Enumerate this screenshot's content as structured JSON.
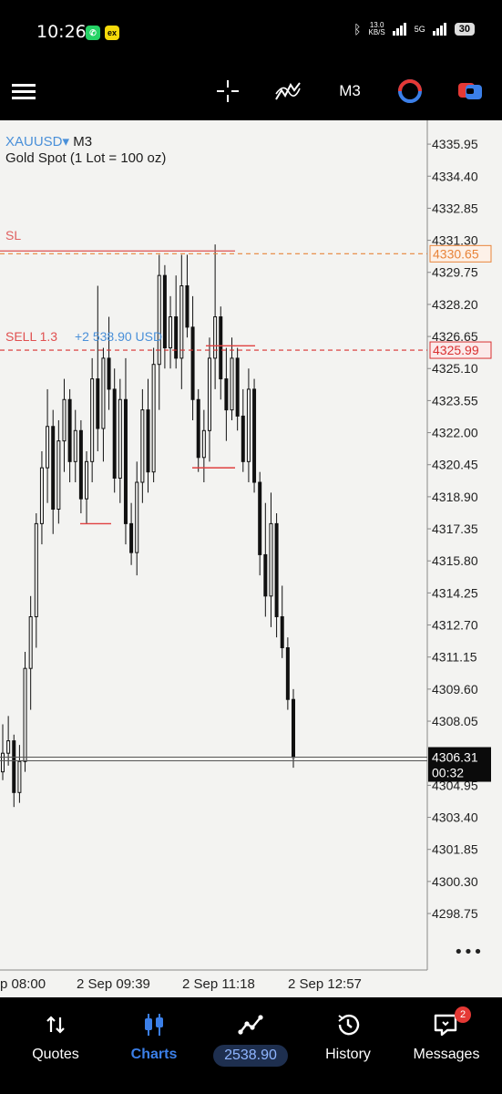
{
  "status_bar": {
    "time": "10:26",
    "app_icons": [
      "whatsapp-icon",
      "ex-app-icon"
    ],
    "net_speed": "13.0",
    "net_unit": "KB/S",
    "network": "5G",
    "battery": "30"
  },
  "toolbar": {
    "timeframe": "M3",
    "icons": [
      "menu-icon",
      "crosshair-icon",
      "indicators-icon",
      "timeframe",
      "objects-icon",
      "trade-icon"
    ]
  },
  "chart": {
    "symbol": "XAUUSD",
    "symbol_arrow": "▾",
    "timeframe": "M3",
    "description": "Gold Spot (1 Lot = 100 oz)",
    "sl_label": "SL",
    "sl_price": "4330.65",
    "sell_label": "SELL 1.3",
    "sell_pl": "+2 538.90 USD",
    "sell_price": "4325.99",
    "current_price": "4306.31",
    "countdown": "00:32",
    "more": "•••",
    "colors": {
      "sl": "#e8843a",
      "sell": "#d93030",
      "candle": "#111111",
      "bg": "#f3f3f1"
    }
  },
  "chart_data": {
    "type": "candlestick",
    "y_ticks": [
      "4335.95",
      "4334.40",
      "4332.85",
      "4331.30",
      "4329.75",
      "4328.20",
      "4326.65",
      "4325.10",
      "4323.55",
      "4322.00",
      "4320.45",
      "4318.90",
      "4317.35",
      "4315.80",
      "4314.25",
      "4312.70",
      "4311.15",
      "4309.60",
      "4308.05",
      "4304.95",
      "4303.40",
      "4301.85",
      "4300.30",
      "4298.75"
    ],
    "x_ticks": [
      "p 08:00",
      "2 Sep 09:39",
      "2 Sep 11:18",
      "2 Sep 12:57"
    ],
    "ylim": [
      4296.9,
      4337.1
    ],
    "candles": [
      [
        4305.6,
        4307.9,
        4305.2,
        4306.5
      ],
      [
        4306.5,
        4308.3,
        4305.9,
        4307.1
      ],
      [
        4307.1,
        4307.4,
        4303.9,
        4304.6
      ],
      [
        4304.6,
        4306.9,
        4304.1,
        4306.1
      ],
      [
        4306.1,
        4311.4,
        4305.6,
        4310.6
      ],
      [
        4310.6,
        4314.1,
        4308.6,
        4313.1
      ],
      [
        4313.1,
        4318.1,
        4311.6,
        4317.6
      ],
      [
        4317.6,
        4321.1,
        4316.6,
        4320.3
      ],
      [
        4320.3,
        4324.1,
        4318.6,
        4322.3
      ],
      [
        4322.3,
        4323.1,
        4317.1,
        4318.3
      ],
      [
        4318.3,
        4322.6,
        4317.6,
        4321.6
      ],
      [
        4321.6,
        4324.6,
        4320.1,
        4323.6
      ],
      [
        4323.6,
        4324.1,
        4319.6,
        4320.6
      ],
      [
        4320.6,
        4323.1,
        4319.6,
        4322.1
      ],
      [
        4322.1,
        4322.6,
        4318.1,
        4318.8
      ],
      [
        4318.8,
        4321.1,
        4317.6,
        4320.6
      ],
      [
        4320.6,
        4325.6,
        4319.6,
        4324.6
      ],
      [
        4324.6,
        4329.1,
        4321.1,
        4322.2
      ],
      [
        4322.2,
        4326.1,
        4320.6,
        4325.6
      ],
      [
        4325.6,
        4327.6,
        4323.1,
        4324.1
      ],
      [
        4324.1,
        4325.1,
        4319.1,
        4319.8
      ],
      [
        4319.8,
        4324.6,
        4318.6,
        4323.6
      ],
      [
        4323.6,
        4325.6,
        4316.6,
        4317.6
      ],
      [
        4317.6,
        4318.6,
        4315.6,
        4316.2
      ],
      [
        4316.2,
        4320.6,
        4315.1,
        4319.6
      ],
      [
        4319.6,
        4324.1,
        4318.6,
        4323.1
      ],
      [
        4323.1,
        4324.6,
        4319.1,
        4320.1
      ],
      [
        4320.1,
        4326.1,
        4319.6,
        4325.3
      ],
      [
        4325.3,
        4330.6,
        4323.1,
        4329.6
      ],
      [
        4329.6,
        4330.1,
        4325.1,
        4326.1
      ],
      [
        4326.1,
        4328.6,
        4325.1,
        4327.6
      ],
      [
        4327.6,
        4329.6,
        4325.1,
        4325.6
      ],
      [
        4325.6,
        4330.6,
        4324.1,
        4329.1
      ],
      [
        4329.1,
        4330.6,
        4326.6,
        4327.1
      ],
      [
        4327.1,
        4328.6,
        4322.6,
        4323.6
      ],
      [
        4323.6,
        4324.1,
        4320.1,
        4320.8
      ],
      [
        4320.8,
        4323.1,
        4319.6,
        4322.1
      ],
      [
        4322.1,
        4326.6,
        4320.6,
        4325.6
      ],
      [
        4325.6,
        4331.1,
        4324.1,
        4327.6
      ],
      [
        4327.6,
        4328.1,
        4323.6,
        4324.6
      ],
      [
        4324.6,
        4326.1,
        4321.6,
        4323.1
      ],
      [
        4323.1,
        4326.6,
        4322.6,
        4325.6
      ],
      [
        4325.6,
        4326.1,
        4322.1,
        4322.8
      ],
      [
        4322.8,
        4324.1,
        4320.1,
        4320.6
      ],
      [
        4320.6,
        4325.1,
        4319.6,
        4324.1
      ],
      [
        4324.1,
        4324.6,
        4319.1,
        4319.6
      ],
      [
        4319.6,
        4320.1,
        4315.1,
        4316.1
      ],
      [
        4316.1,
        4318.6,
        4313.1,
        4314.1
      ],
      [
        4314.1,
        4319.1,
        4312.6,
        4317.6
      ],
      [
        4317.6,
        4318.1,
        4312.1,
        4313.1
      ],
      [
        4313.1,
        4314.6,
        4311.1,
        4311.6
      ],
      [
        4311.6,
        4312.1,
        4308.6,
        4309.1
      ],
      [
        4309.1,
        4309.6,
        4305.8,
        4306.3
      ]
    ],
    "horizontal_lines": [
      {
        "label": "SL",
        "value": 4330.65,
        "style": "dashed"
      },
      {
        "label": "SELL 1.3",
        "value": 4325.99,
        "style": "dashed"
      },
      {
        "label": "current",
        "value": 4306.31,
        "style": "solid"
      }
    ],
    "grid": false
  },
  "bottom_nav": [
    {
      "label": "Quotes",
      "icon": "quotes-arrows-icon",
      "active": false
    },
    {
      "label": "Charts",
      "icon": "candlestick-icon",
      "active": true
    },
    {
      "label": "2538.90",
      "icon": "trade-chart-icon",
      "active": false
    },
    {
      "label": "History",
      "icon": "history-clock-icon",
      "active": false
    },
    {
      "label": "Messages",
      "icon": "messages-icon",
      "active": false,
      "badge": "2"
    }
  ]
}
